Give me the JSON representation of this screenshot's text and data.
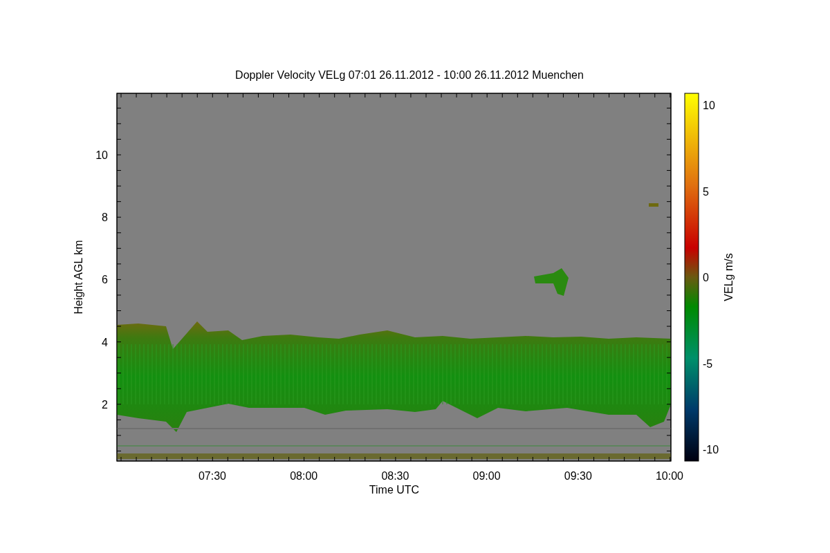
{
  "figure": {
    "title": "Doppler Velocity VELg   07:01 26.11.2012 - 10:00 26.11.2012 Muenchen",
    "xlabel": "Time UTC",
    "ylabel": "Height AGL km",
    "xticks": [
      "07:30",
      "08:00",
      "08:30",
      "09:00",
      "09:30",
      "10:00"
    ],
    "yticks": [
      "10",
      "8",
      "6",
      "4",
      "2"
    ],
    "colorbar": {
      "label": "VELg m/s",
      "ticks": [
        "10",
        "5",
        "0",
        "-5",
        "-10"
      ]
    }
  }
}
